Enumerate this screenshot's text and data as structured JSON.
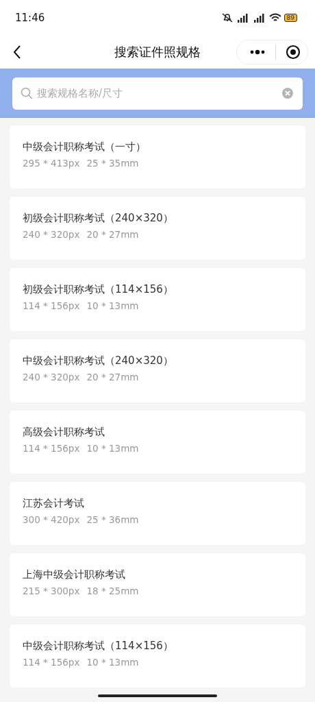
{
  "status_bar": {
    "time": "11:46",
    "battery": "89"
  },
  "nav": {
    "title": "搜索证件照规格"
  },
  "search": {
    "placeholder": "搜索规格名称/尺寸"
  },
  "specs": [
    {
      "name": "中级会计职称考试（一寸）",
      "pixels": "295 * 413px",
      "size": "25 * 35mm"
    },
    {
      "name": "初级会计职称考试（240×320）",
      "pixels": "240 * 320px",
      "size": "20 * 27mm"
    },
    {
      "name": "初级会计职称考试（114×156）",
      "pixels": "114 * 156px",
      "size": "10 * 13mm"
    },
    {
      "name": "中级会计职称考试（240×320）",
      "pixels": "240 * 320px",
      "size": "20 * 27mm"
    },
    {
      "name": "高级会计职称考试",
      "pixels": "114 * 156px",
      "size": "10 * 13mm"
    },
    {
      "name": "江苏会计考试",
      "pixels": "300 * 420px",
      "size": "25 * 36mm"
    },
    {
      "name": "上海中级会计职称考试",
      "pixels": "215 * 300px",
      "size": "18 * 25mm"
    },
    {
      "name": "中级会计职称考试（114×156）",
      "pixels": "114 * 156px",
      "size": "10 * 13mm"
    }
  ]
}
